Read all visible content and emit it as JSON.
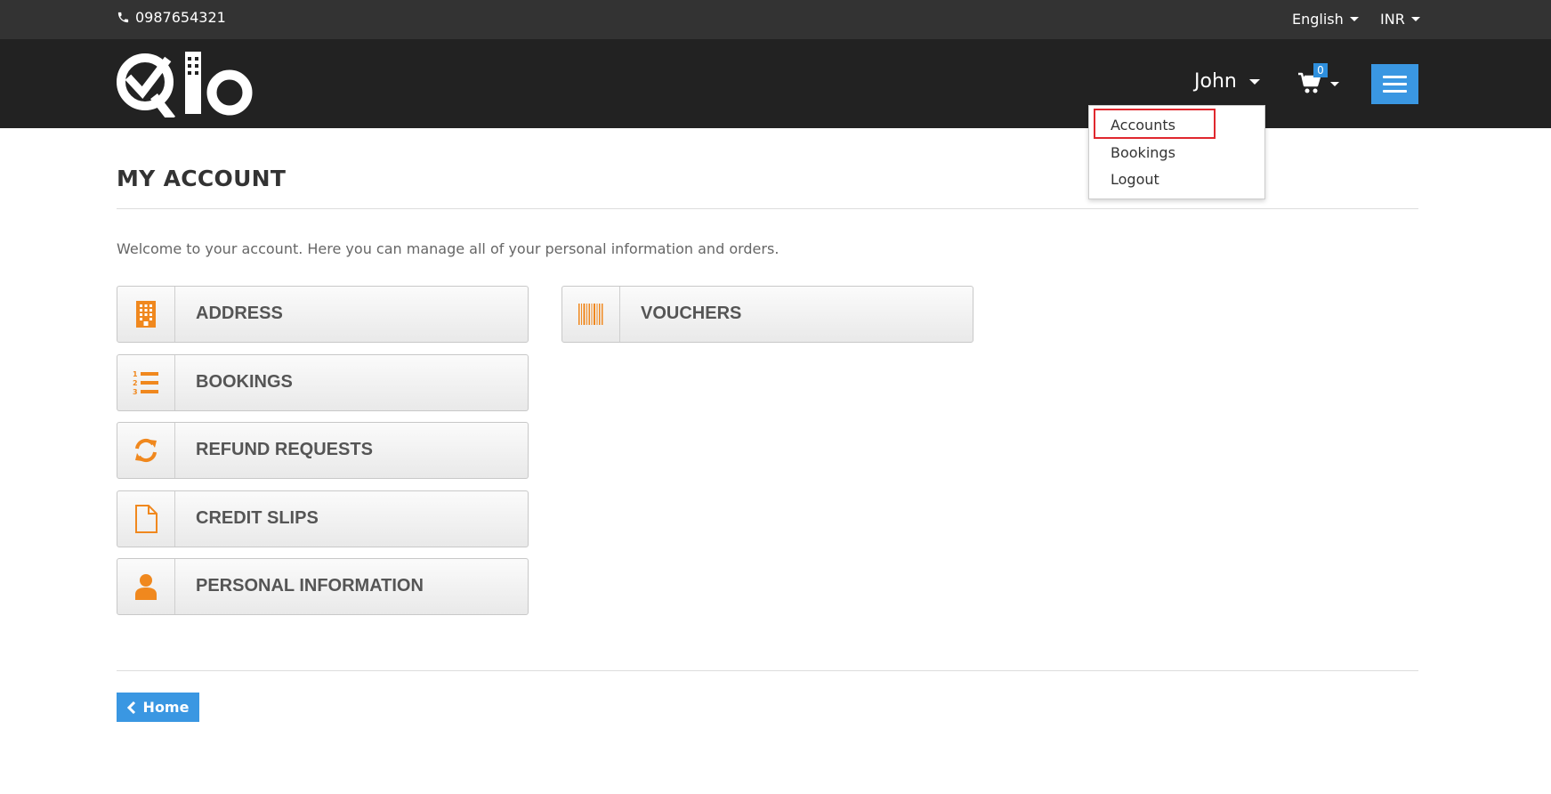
{
  "top_bar": {
    "phone": "0987654321",
    "language": "English",
    "currency": "INR"
  },
  "header": {
    "logo_icon": "qlo-logo-icon",
    "user_name": "John",
    "cart_count": "0"
  },
  "user_dropdown": {
    "items": [
      {
        "label": "Accounts"
      },
      {
        "label": "Bookings"
      },
      {
        "label": "Logout"
      }
    ]
  },
  "page": {
    "title": "MY ACCOUNT",
    "welcome": "Welcome to your account. Here you can manage all of your personal information and orders.",
    "tiles": [
      {
        "label": "ADDRESS",
        "icon": "building-icon"
      },
      {
        "label": "BOOKINGS",
        "icon": "ordered-list-icon"
      },
      {
        "label": "REFUND REQUESTS",
        "icon": "refresh-icon"
      },
      {
        "label": "CREDIT SLIPS",
        "icon": "file-icon"
      },
      {
        "label": "PERSONAL INFORMATION",
        "icon": "user-icon"
      },
      {
        "label": "VOUCHERS",
        "icon": "barcode-icon"
      }
    ],
    "home_button": "Home"
  },
  "colors": {
    "accent": "#3a97e2",
    "icon_orange": "#f0881e",
    "header_bg": "#222222",
    "top_bar_bg": "#333333",
    "highlight_red": "#e0282e"
  }
}
